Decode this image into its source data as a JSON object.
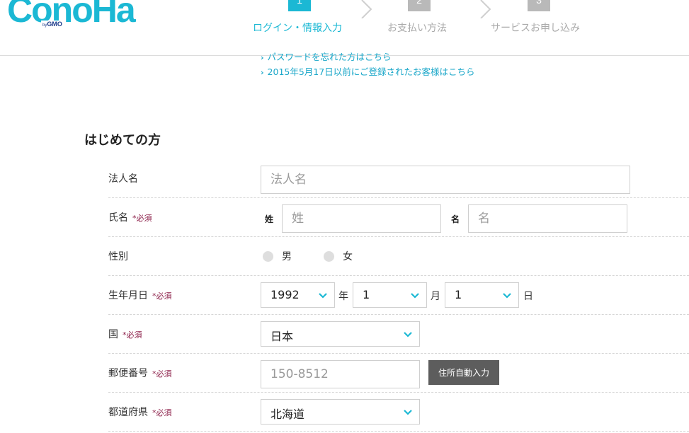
{
  "logo": {
    "text": "ConoHa",
    "by": "by",
    "gmo": "GMO"
  },
  "steps": [
    {
      "num": "1",
      "label": "ログイン・情報入力",
      "state": "active"
    },
    {
      "num": "2",
      "label": "お支払い方法",
      "state": "inactive"
    },
    {
      "num": "3",
      "label": "サービスお申し込み",
      "state": "inactive"
    }
  ],
  "links": [
    {
      "arrow": "›",
      "text": "パスワードを忘れた方はこちら"
    },
    {
      "arrow": "›",
      "text": "2015年5月17日以前にご登録されたお客様はこちら"
    }
  ],
  "section_title": "はじめての方",
  "required_mark": "*必須",
  "form": {
    "company": {
      "label": "法人名",
      "placeholder": "法人名"
    },
    "name": {
      "label": "氏名",
      "last_label": "姓",
      "last_placeholder": "姓",
      "first_label": "名",
      "first_placeholder": "名"
    },
    "gender": {
      "label": "性別",
      "options": [
        "男",
        "女"
      ]
    },
    "birthday": {
      "label": "生年月日",
      "year": "1992",
      "year_unit": "年",
      "month": "1",
      "month_unit": "月",
      "day": "1",
      "day_unit": "日"
    },
    "country": {
      "label": "国",
      "value": "日本"
    },
    "postal": {
      "label": "郵便番号",
      "placeholder": "150-8512",
      "button": "住所自動入力"
    },
    "prefecture": {
      "label": "都道府県",
      "value": "北海道"
    }
  },
  "colors": {
    "accent": "#1bb8d4",
    "required": "#8b1d47",
    "inactive_step": "#b9b9b9",
    "button": "#5d5d5d"
  }
}
